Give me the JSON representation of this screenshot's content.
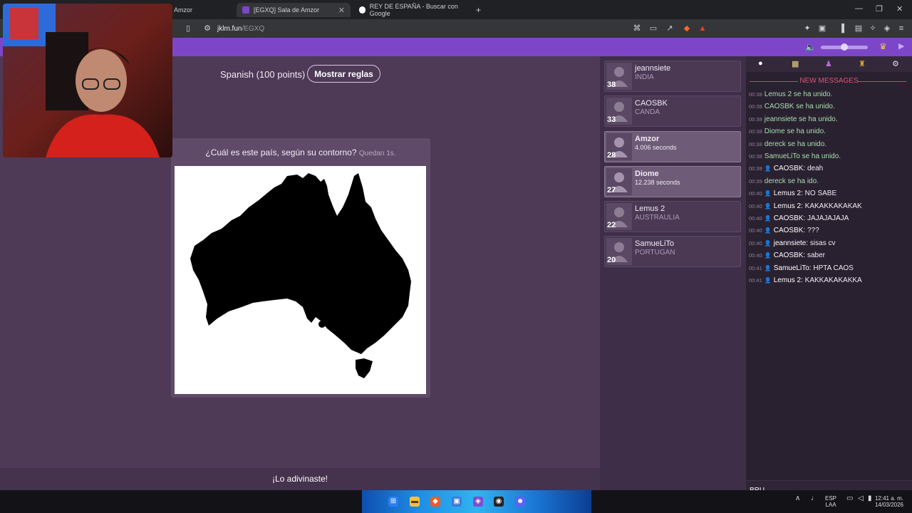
{
  "browser": {
    "tabs": [
      {
        "title": "Amzor",
        "active": false
      },
      {
        "title": "[EGXQ] Sala de Amzor",
        "active": true
      },
      {
        "title": "REY DE ESPAÑA - Buscar con Google",
        "active": false
      }
    ],
    "new_tab_symbol": "+",
    "url_host": "jklm.fun",
    "url_path": "/EGXQ",
    "window_controls": [
      "—",
      "❐",
      "✕"
    ]
  },
  "game": {
    "mode": "Spanish (100 points)",
    "rules_button": "Mostrar reglas",
    "question": "¿Cuál es este país, según su contorno?",
    "timer": "Quedan 1s.",
    "result": "¡Lo adivinaste!",
    "answer_shape": "australia-outline"
  },
  "players": [
    {
      "name": "jeannsiete",
      "guess": "INDIA",
      "score": "38",
      "highlight": false
    },
    {
      "name": "CAOSBK",
      "guess": "CANDA",
      "score": "33",
      "highlight": false
    },
    {
      "name": "Amzor",
      "guess": "4.006 seconds",
      "score": "28",
      "highlight": true
    },
    {
      "name": "Diome",
      "guess": "12.238 seconds",
      "score": "27",
      "highlight": true
    },
    {
      "name": "Lemus 2",
      "guess": "AUSTRAULIA",
      "score": "22",
      "highlight": false
    },
    {
      "name": "SamueLiTo",
      "guess": "PORTUGAN",
      "score": "20",
      "highlight": false
    }
  ],
  "chat": {
    "new_messages_label": "NEW MESSAGES",
    "messages": [
      {
        "time": "00:38",
        "user": "",
        "text": "Lemus 2 se ha unido.",
        "system": true
      },
      {
        "time": "00:38",
        "user": "",
        "text": "CAOSBK se ha unido.",
        "system": true
      },
      {
        "time": "00:38",
        "user": "",
        "text": "jeannsiete se ha unido.",
        "system": true
      },
      {
        "time": "00:38",
        "user": "",
        "text": "Diome se ha unido.",
        "system": true
      },
      {
        "time": "00:38",
        "user": "",
        "text": "dereck se ha unido.",
        "system": true
      },
      {
        "time": "00:38",
        "user": "",
        "text": "SamueLiTo se ha unido.",
        "system": true
      },
      {
        "time": "00:39",
        "user": "CAOSBK",
        "text": "deah",
        "system": false
      },
      {
        "time": "00:39",
        "user": "",
        "text": "dereck se ha ido.",
        "system": true
      },
      {
        "time": "00:40",
        "user": "Lemus 2",
        "text": "NO SABE",
        "system": false
      },
      {
        "time": "00:40",
        "user": "Lemus 2",
        "text": "KAKAKKAKAKAK",
        "system": false
      },
      {
        "time": "00:40",
        "user": "CAOSBK",
        "text": "JAJAJAJAJA",
        "system": false
      },
      {
        "time": "00:40",
        "user": "CAOSBK",
        "text": "???",
        "system": false
      },
      {
        "time": "00:40",
        "user": "jeannsiete",
        "text": "sisas cv",
        "system": false
      },
      {
        "time": "00:40",
        "user": "CAOSBK",
        "text": "saber",
        "system": false
      },
      {
        "time": "00:41",
        "user": "SamueLiTo",
        "text": "HPTA CAOS",
        "system": false
      },
      {
        "time": "00:41",
        "user": "Lemus 2",
        "text": "KAKKAKAKAKKA",
        "system": false
      }
    ],
    "input_value": "BRU"
  },
  "taskbar": {
    "lang": "ESP",
    "layout": "LAA",
    "time": "12:41 a. m.",
    "date": "14/03/2026"
  },
  "colors": {
    "accent": "#7d46c8",
    "background": "#4e3a57",
    "system_message": "#a8dfae",
    "new_messages": "#e05575"
  }
}
